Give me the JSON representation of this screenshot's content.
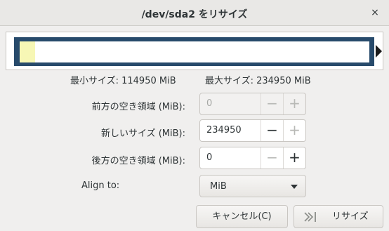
{
  "window": {
    "title": "/dev/sda2 をリサイズ",
    "close_glyph": "×"
  },
  "info": {
    "min_size": "最小サイズ: 114950 MiB",
    "max_size": "最大サイズ: 234950 MiB"
  },
  "fields": {
    "free_before": {
      "label": "前方の空き領域 (MiB):",
      "value": "0",
      "enabled": false
    },
    "new_size": {
      "label": "新しいサイズ (MiB):",
      "value": "234950",
      "enabled": true
    },
    "free_after": {
      "label": "後方の空き領域 (MiB):",
      "value": "0",
      "enabled": true
    }
  },
  "align": {
    "label": "Align to:",
    "selected": "MiB"
  },
  "buttons": {
    "cancel": "キャンセル(C)",
    "resize": "リサイズ"
  },
  "partition": {
    "used_fraction": 0.045,
    "used_color": "#f7f7b5",
    "frame_color": "#274a6b"
  },
  "icons": {
    "close": "close-icon",
    "combo": "chevron-down-icon",
    "resize": "resize-icon",
    "handle": "resize-handle-icon"
  },
  "glyphs": {
    "minus": "−",
    "plus": "+"
  }
}
